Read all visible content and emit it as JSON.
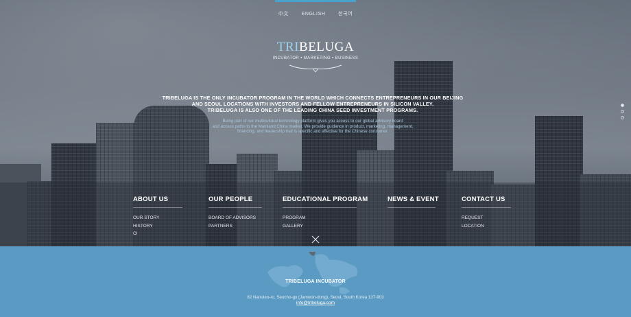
{
  "languages": [
    "中文",
    "ENGLISH",
    "한국어"
  ],
  "logo": {
    "word_prefix": "TRI",
    "word_suffix": "BELUGA",
    "tagline": "INCUBATOR • MARKETING • BUSINESS"
  },
  "intro": {
    "headline_lines": [
      "TRIBELUGA IS THE ONLY INCUBATOR PROGRAM IN THE WORLD WHICH CONNECTS ENTREPRENEURS IN OUR BEIJING",
      "AND SEOUL LOCATIONS WITH INVESTORS AND FELLOW ENTREPRENEURS IN SILICON VALLEY.",
      "TRIBELUGA IS ALSO ONE OF THE LEADING CHINA SEED INVESTMENT PROGRAMS."
    ],
    "sub_lines": [
      "Being part of our multicultural technology platform gives you access to our global advisory board",
      "and access paths to the Mainland China market. We provide guidance in product, marketing, management,",
      "financing, and leadership that is specific and effective for the Chinese consumer."
    ]
  },
  "nav": {
    "about": {
      "title": "ABOUT US",
      "items": [
        "OUR STORY",
        "HISTORY",
        "CI"
      ]
    },
    "people": {
      "title": "OUR PEOPLE",
      "items": [
        "BOARD OF ADVISORS",
        "PARTNERS"
      ]
    },
    "program": {
      "title": "EDUCATIONAL PROGRAM",
      "items": [
        "PROGRAM",
        "GALLERY"
      ]
    },
    "news": {
      "title": "NEWS & EVENT",
      "items": []
    },
    "contact": {
      "title": "CONTACT US",
      "items": [
        "REQUEST",
        "LOCATION"
      ]
    }
  },
  "footer": {
    "title": "TRIBELUGA INCUBATOR",
    "address": "82 Nanuteo-ro, Seocho-gu (Jamwon-dong), Seoul, South Korea 137-903",
    "email": "info@tribeluga.com"
  },
  "colors": {
    "accent": "#4aa3cf",
    "footer_bg": "#5b9bc3",
    "logo_highlight": "#9fd0ea"
  }
}
